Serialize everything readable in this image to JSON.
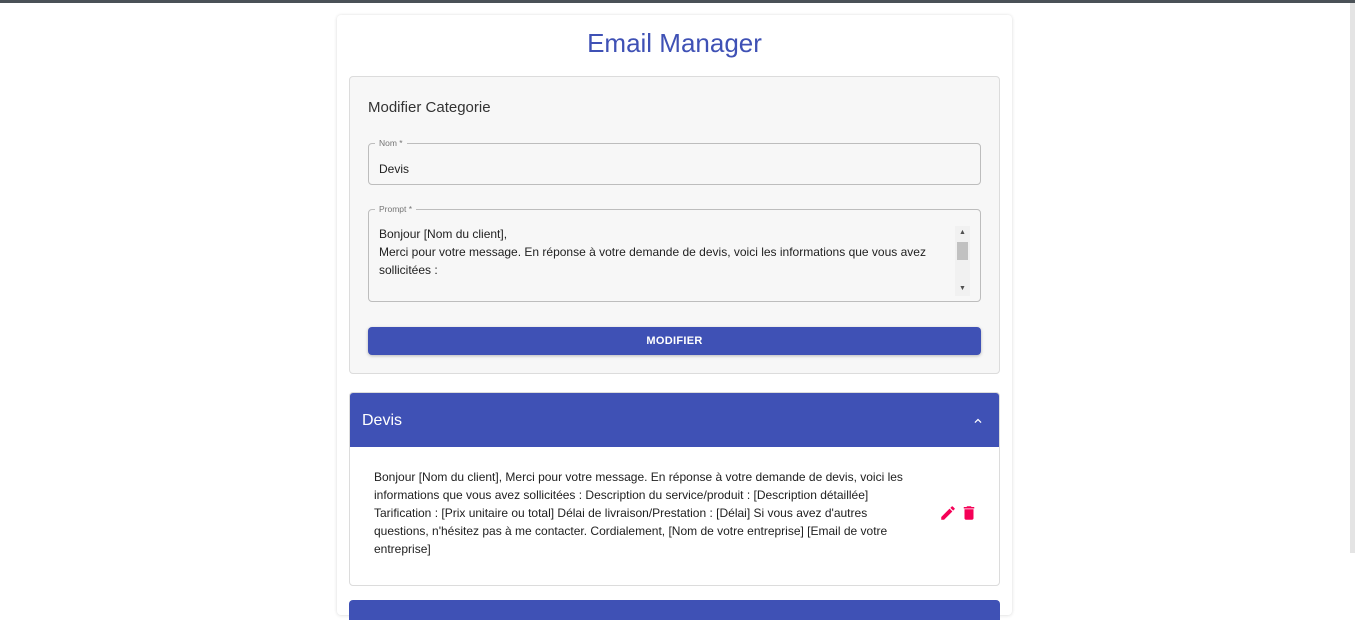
{
  "app": {
    "title": "Email Manager"
  },
  "form": {
    "title": "Modifier Categorie",
    "name_label": "Nom *",
    "name_value": "Devis",
    "prompt_label": "Prompt *",
    "prompt_lines": [
      "Bonjour [Nom du client],",
      "",
      "Merci pour votre message. En réponse à votre demande de devis, voici les informations que vous avez sollicitées :"
    ],
    "submit_label": "MODIFIER"
  },
  "categories": [
    {
      "name": "Devis",
      "expanded": true,
      "content": "Bonjour [Nom du client], Merci pour votre message. En réponse à votre demande de devis, voici les informations que vous avez sollicitées : Description du service/produit : [Description détaillée] Tarification : [Prix unitaire ou total] Délai de livraison/Prestation : [Délai] Si vous avez d'autres questions, n'hésitez pas à me contacter. Cordialement, [Nom de votre entreprise] [Email de votre entreprise]"
    }
  ],
  "icons": {
    "collapse": "chevron-up-icon",
    "edit": "pencil-icon",
    "delete": "trash-icon"
  },
  "colors": {
    "primary": "#3f51b5",
    "accent": "#f50057",
    "panel_background": "#f7f7f7"
  }
}
